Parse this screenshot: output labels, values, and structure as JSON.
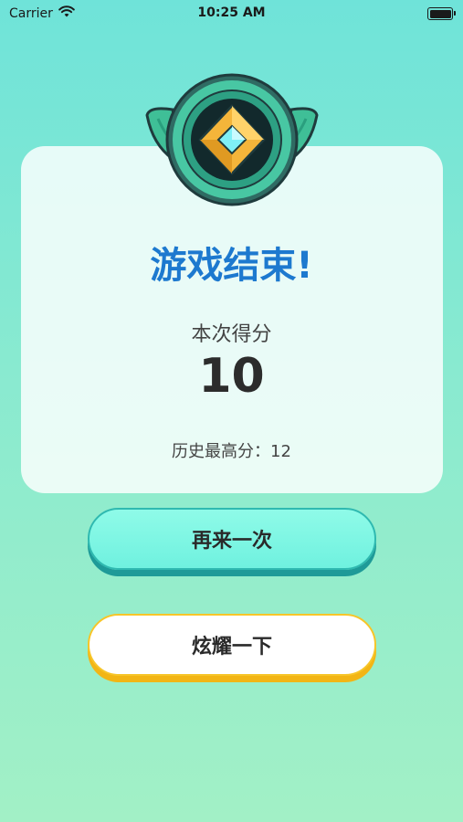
{
  "status_bar": {
    "carrier": "Carrier",
    "time": "10:25 AM",
    "battery_level": 1.0
  },
  "game_over": {
    "title": "游戏结束!",
    "score_label": "本次得分",
    "score_value": "10",
    "best_score_label": "历史最高分：",
    "best_score_value": "12"
  },
  "buttons": {
    "retry_label": "再来一次",
    "share_label": "炫耀一下"
  },
  "colors": {
    "title": "#1d79cf",
    "retry_button": "#7ff6e4",
    "share_border": "#f7c528"
  }
}
